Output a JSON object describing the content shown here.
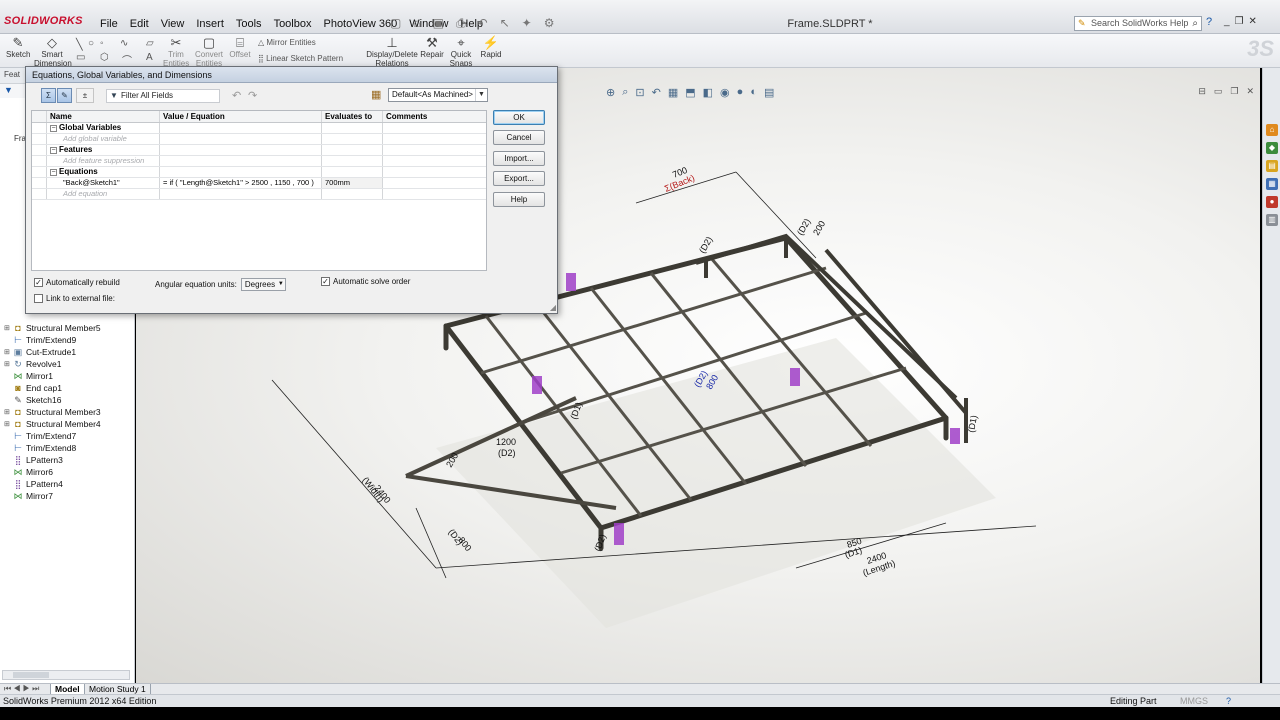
{
  "app": {
    "logo_text": "SOLIDWORKS",
    "document_title": "Frame.SLDPRT *"
  },
  "menus": [
    "File",
    "Edit",
    "View",
    "Insert",
    "Tools",
    "Toolbox",
    "PhotoView 360",
    "Window",
    "Help"
  ],
  "search": {
    "placeholder": "Search SolidWorks Help"
  },
  "commands": {
    "sketch": "Sketch",
    "smart_dimension": "Smart Dimension",
    "trim_entities": "Trim Entities",
    "convert_entities": "Convert Entities",
    "offset": "Offset",
    "mirror_entities": "Mirror Entities",
    "linear_sketch_pattern": "Linear Sketch Pattern",
    "display_delete_relations": "Display/Delete Relations",
    "repair": "Repair",
    "quick_snaps": "Quick Snaps",
    "rapid": "Rapid"
  },
  "feature_tree": {
    "tab_label": "Feat",
    "partial_labels": [
      "Fra"
    ],
    "items": [
      {
        "label": "Structural Member5",
        "icon": "structural-member-icon"
      },
      {
        "label": "Trim/Extend9",
        "icon": "trim-extend-icon"
      },
      {
        "label": "Cut-Extrude1",
        "icon": "cut-extrude-icon"
      },
      {
        "label": "Revolve1",
        "icon": "revolve-icon"
      },
      {
        "label": "Mirror1",
        "icon": "mirror-icon"
      },
      {
        "label": "End cap1",
        "icon": "end-cap-icon"
      },
      {
        "label": "Sketch16",
        "icon": "sketch-icon"
      },
      {
        "label": "Structural Member3",
        "icon": "structural-member-icon"
      },
      {
        "label": "Structural Member4",
        "icon": "structural-member-icon"
      },
      {
        "label": "Trim/Extend7",
        "icon": "trim-extend-icon"
      },
      {
        "label": "Trim/Extend8",
        "icon": "trim-extend-icon"
      },
      {
        "label": "LPattern3",
        "icon": "linear-pattern-icon"
      },
      {
        "label": "Mirror6",
        "icon": "mirror-icon"
      },
      {
        "label": "LPattern4",
        "icon": "linear-pattern-icon"
      },
      {
        "label": "Mirror7",
        "icon": "mirror-icon"
      }
    ]
  },
  "equations_dialog": {
    "title": "Equations, Global Variables, and Dimensions",
    "filter_label": "Filter All Fields",
    "configuration": "Default<As Machined>",
    "columns": [
      "Name",
      "Value / Equation",
      "Evaluates to",
      "Comments"
    ],
    "sections": {
      "global_variables": {
        "label": "Global Variables",
        "placeholder": "Add global variable"
      },
      "features": {
        "label": "Features",
        "placeholder": "Add feature suppression"
      },
      "equations": {
        "label": "Equations",
        "rows": [
          {
            "name": "\"Back@Sketch1\"",
            "value": "= if ( \"Length@Sketch1\" > 2500 , 1150 , 700 )",
            "evaluates": "700mm",
            "comment": ""
          }
        ],
        "placeholder": "Add equation"
      }
    },
    "buttons": {
      "ok": "OK",
      "cancel": "Cancel",
      "import": "Import...",
      "export": "Export...",
      "help": "Help"
    },
    "auto_rebuild": {
      "label": "Automatically rebuild",
      "checked": true
    },
    "link_external": {
      "label": "Link to external file:",
      "checked": false
    },
    "angular_units": {
      "label": "Angular equation units:",
      "value": "Degrees"
    },
    "auto_solve": {
      "label": "Automatic solve order",
      "checked": true
    }
  },
  "dimensions": {
    "back_top": "700",
    "back_name": "Σ(Back)",
    "d2_top": "(D2)",
    "d2_right": "(D2)",
    "d2_mid": "(D2)",
    "d1_mid": "(D1)",
    "center": "800",
    "d1_right": "(D1)",
    "d2_left": "(D2)",
    "len_1200": "1200",
    "d2_1200": "(D2)",
    "v200": "200",
    "width_2400": "2400",
    "width_name": "(Width)",
    "dim_800": "800",
    "d2_800": "(D2)",
    "d2_bottom": "(D2)",
    "dim_850": "850",
    "d1_850": "(D1)",
    "length_2400": "2400",
    "length_name": "(Length)",
    "top_right_200": "200"
  },
  "bottom_tabs": [
    "Model",
    "Motion Study 1"
  ],
  "status": {
    "edition": "SolidWorks Premium 2012 x64 Edition",
    "mode": "Editing Part",
    "units": "MMGS"
  }
}
